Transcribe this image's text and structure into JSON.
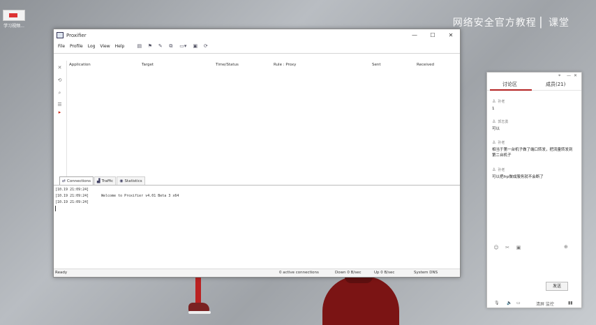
{
  "desktop": {
    "icon_label": "学习视频...",
    "watermark": "网络安全官方教程 ▏课堂"
  },
  "window": {
    "title": "Proxifier",
    "controls": {
      "minimize": "—",
      "maximize": "☐",
      "close": "✕"
    },
    "menu": [
      "File",
      "Profile",
      "Log",
      "View",
      "Help"
    ],
    "columns": [
      "Application",
      "Target",
      "Time/Status",
      "Rule : Proxy",
      "Sent",
      "Received"
    ],
    "tabs": [
      "Connections",
      "Traffic",
      "Statistics"
    ],
    "log": [
      {
        "ts": "[10.19 21:09:24]",
        "msg": ""
      },
      {
        "ts": "[10.19 21:09:24]",
        "msg": "Welcome to Proxifier v4.01 Beta 3 x64"
      },
      {
        "ts": "[10.19 21:09:24]",
        "msg": ""
      }
    ],
    "status": {
      "ready": "Ready",
      "connections": "0 active connections",
      "down": "Down 0 B/sec",
      "up": "Up 0 B/sec",
      "dns": "System DNS"
    }
  },
  "chat": {
    "tab_discuss": "讨论区",
    "tab_members": "成员(21)",
    "messages": [
      {
        "user": "孙老",
        "text": "1"
      },
      {
        "user": "郭志勇",
        "text": "可以"
      },
      {
        "user": "孙老",
        "text": "相当于第一台机子做了端口转发，把流量转发到第二台机子"
      },
      {
        "user": "孙老",
        "text": "可以把frp做成服务就不会断了"
      }
    ],
    "send_label": "发送",
    "bottom_label": "清屏 监控"
  }
}
